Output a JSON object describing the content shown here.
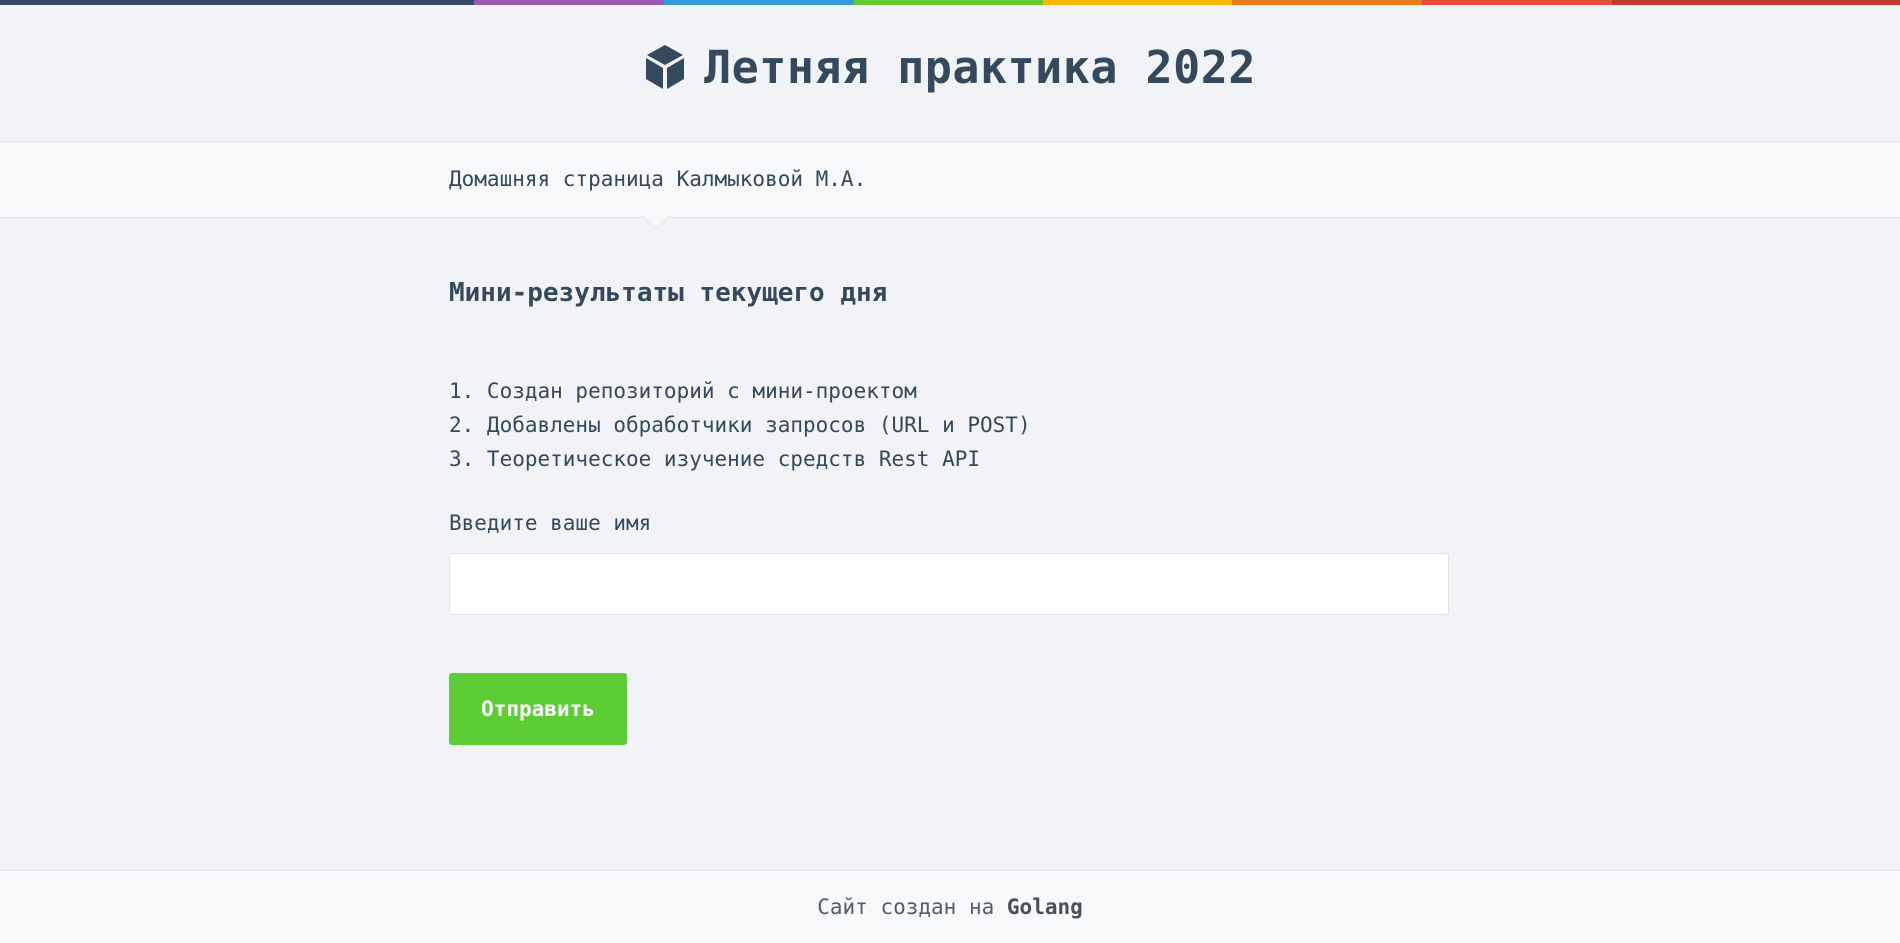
{
  "top_stripe_colors": [
    "#34495e",
    "#9b59b6",
    "#3498db",
    "#62cb31",
    "#ffb606",
    "#e67e22",
    "#e74c3c",
    "#c0392b"
  ],
  "header": {
    "icon": "cube-icon",
    "title": "Летняя практика 2022"
  },
  "nav": {
    "home_link": "Домашняя страница Калмыковой М.А."
  },
  "main": {
    "heading": "Мини-результаты текущего дня",
    "results": [
      "1. Создан репозиторий с мини-проектом",
      "2. Добавлены обработчики запросов (URL и POST)",
      "3. Теоретическое изучение средств Rest API"
    ],
    "name_label": "Введите ваше имя",
    "name_value": "",
    "submit_label": "Отправить"
  },
  "footer": {
    "prefix": "Сайт создан на",
    "tech": "Golang"
  },
  "colors": {
    "accent_green": "#5ccd35",
    "text": "#34495e",
    "background": "#f2f3f6"
  }
}
